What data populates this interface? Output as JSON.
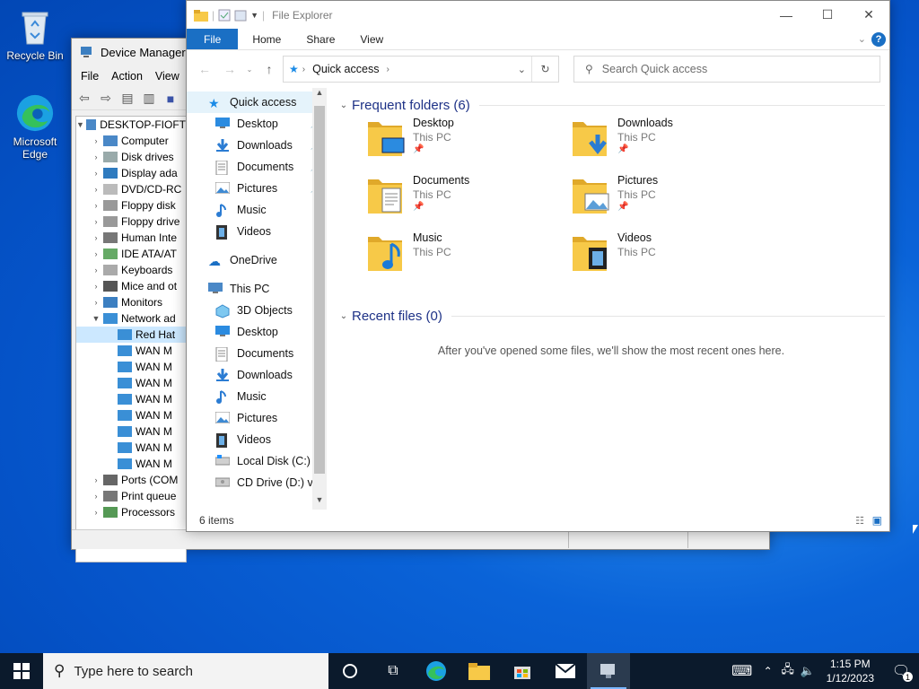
{
  "desktop": {
    "icons": [
      {
        "label": "Recycle Bin"
      },
      {
        "label": "Microsoft Edge"
      }
    ]
  },
  "device_manager": {
    "title": "Device Manager",
    "menu": [
      "File",
      "Action",
      "View"
    ],
    "root": "DESKTOP-FIOFT",
    "nodes": [
      {
        "label": "Computer"
      },
      {
        "label": "Disk drives"
      },
      {
        "label": "Display ada"
      },
      {
        "label": "DVD/CD-RC"
      },
      {
        "label": "Floppy disk"
      },
      {
        "label": "Floppy drive"
      },
      {
        "label": "Human Inte"
      },
      {
        "label": "IDE ATA/AT"
      },
      {
        "label": "Keyboards"
      },
      {
        "label": "Mice and ot"
      },
      {
        "label": "Monitors"
      },
      {
        "label": "Network ad"
      }
    ],
    "network_children": [
      "Red Hat",
      "WAN M",
      "WAN M",
      "WAN M",
      "WAN M",
      "WAN M",
      "WAN M",
      "WAN M",
      "WAN M"
    ],
    "trailing_nodes": [
      {
        "label": "Ports (COM"
      },
      {
        "label": "Print queue"
      },
      {
        "label": "Processors"
      }
    ]
  },
  "explorer": {
    "title": "File Explorer",
    "ribbon_tabs": [
      "File",
      "Home",
      "Share",
      "View"
    ],
    "address": "Quick access",
    "search_placeholder": "Search Quick access",
    "nav": {
      "quick_access": "Quick access",
      "quick_items": [
        {
          "label": "Desktop",
          "icon": "desktop-icon"
        },
        {
          "label": "Downloads",
          "icon": "download-icon"
        },
        {
          "label": "Documents",
          "icon": "document-icon"
        },
        {
          "label": "Pictures",
          "icon": "picture-icon"
        },
        {
          "label": "Music",
          "icon": "music-icon"
        },
        {
          "label": "Videos",
          "icon": "video-icon"
        }
      ],
      "onedrive": "OneDrive",
      "this_pc": "This PC",
      "pc_items": [
        {
          "label": "3D Objects",
          "icon": "cube-icon"
        },
        {
          "label": "Desktop",
          "icon": "desktop-icon"
        },
        {
          "label": "Documents",
          "icon": "document-icon"
        },
        {
          "label": "Downloads",
          "icon": "download-icon"
        },
        {
          "label": "Music",
          "icon": "music-icon"
        },
        {
          "label": "Pictures",
          "icon": "picture-icon"
        },
        {
          "label": "Videos",
          "icon": "video-icon"
        },
        {
          "label": "Local Disk (C:)",
          "icon": "disk-icon"
        },
        {
          "label": "CD Drive (D:) virt",
          "icon": "cd-icon"
        }
      ]
    },
    "frequent_header": "Frequent folders (6)",
    "folders": [
      {
        "name": "Desktop",
        "sub": "This PC",
        "overlay": "desktop",
        "pinned": true
      },
      {
        "name": "Downloads",
        "sub": "This PC",
        "overlay": "download",
        "pinned": true
      },
      {
        "name": "Documents",
        "sub": "This PC",
        "overlay": "document",
        "pinned": true
      },
      {
        "name": "Pictures",
        "sub": "This PC",
        "overlay": "picture",
        "pinned": true
      },
      {
        "name": "Music",
        "sub": "This PC",
        "overlay": "music",
        "pinned": false
      },
      {
        "name": "Videos",
        "sub": "This PC",
        "overlay": "video",
        "pinned": false
      }
    ],
    "recent_header": "Recent files (0)",
    "recent_empty": "After you've opened some files, we'll show the most recent ones here.",
    "status": "6 items"
  },
  "taskbar": {
    "search_placeholder": "Type here to search",
    "time": "1:15 PM",
    "date": "1/12/2023",
    "notification_count": "1"
  },
  "colors": {
    "accent": "#1a6fc4",
    "folder": "#f7c948",
    "taskbar": "#0b1a2c"
  }
}
